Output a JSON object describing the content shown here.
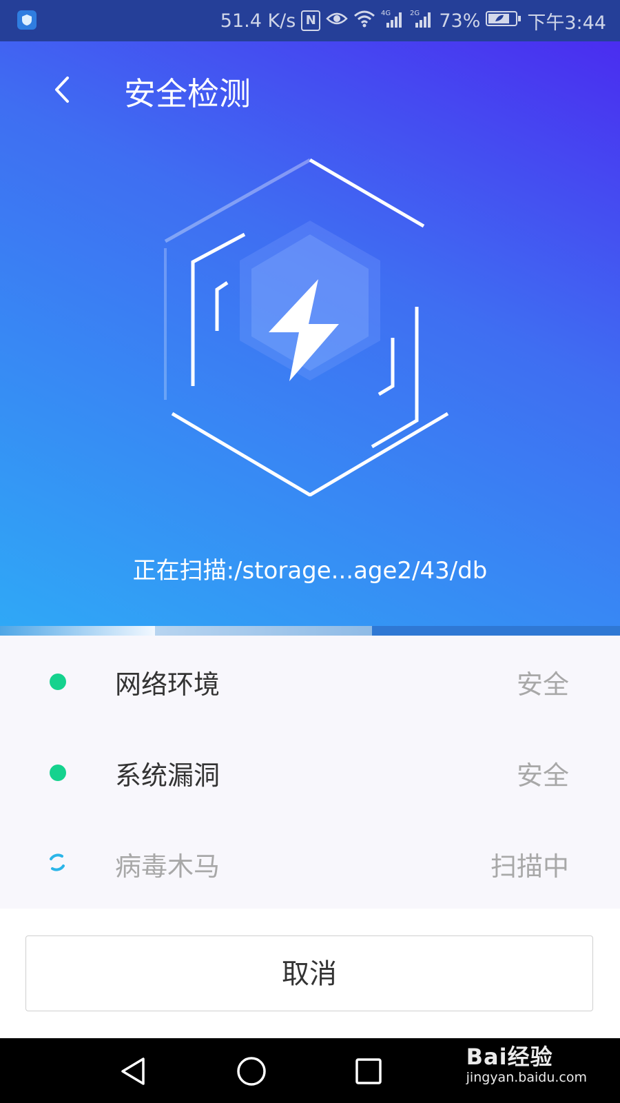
{
  "status_bar": {
    "net_speed": "51.4 K/s",
    "nfc_label": "N",
    "net_4g": "4G",
    "net_2g": "2G",
    "battery": "73%",
    "time": "下午3:44"
  },
  "header": {
    "title": "安全检测",
    "back_icon": "chevron-left-icon"
  },
  "hero": {
    "graphic_icon": "lightning-hexagon-icon",
    "scan_path": "正在扫描:/storage...age2/43/db"
  },
  "progress": {
    "completed_steps": 2,
    "total_steps": 3
  },
  "scan_items": [
    {
      "label": "网络环境",
      "status": "安全",
      "state": "done",
      "color": "#15d28e"
    },
    {
      "label": "系统漏洞",
      "status": "安全",
      "state": "done",
      "color": "#15d28e"
    },
    {
      "label": "病毒木马",
      "status": "扫描中",
      "state": "scanning",
      "color": "#2bb5e8"
    }
  ],
  "actions": {
    "cancel_label": "取消"
  },
  "nav": {
    "back_icon": "triangle-back-icon",
    "home_icon": "circle-home-icon",
    "recents_icon": "square-recents-icon"
  },
  "watermark": {
    "logo": "Bai经验",
    "url": "jingyan.baidu.com"
  },
  "colors": {
    "hero_gradient_start": "#4a2df0",
    "hero_gradient_end": "#2fa8f6",
    "safe_dot": "#15d28e",
    "list_bg": "#f8f7fc"
  }
}
